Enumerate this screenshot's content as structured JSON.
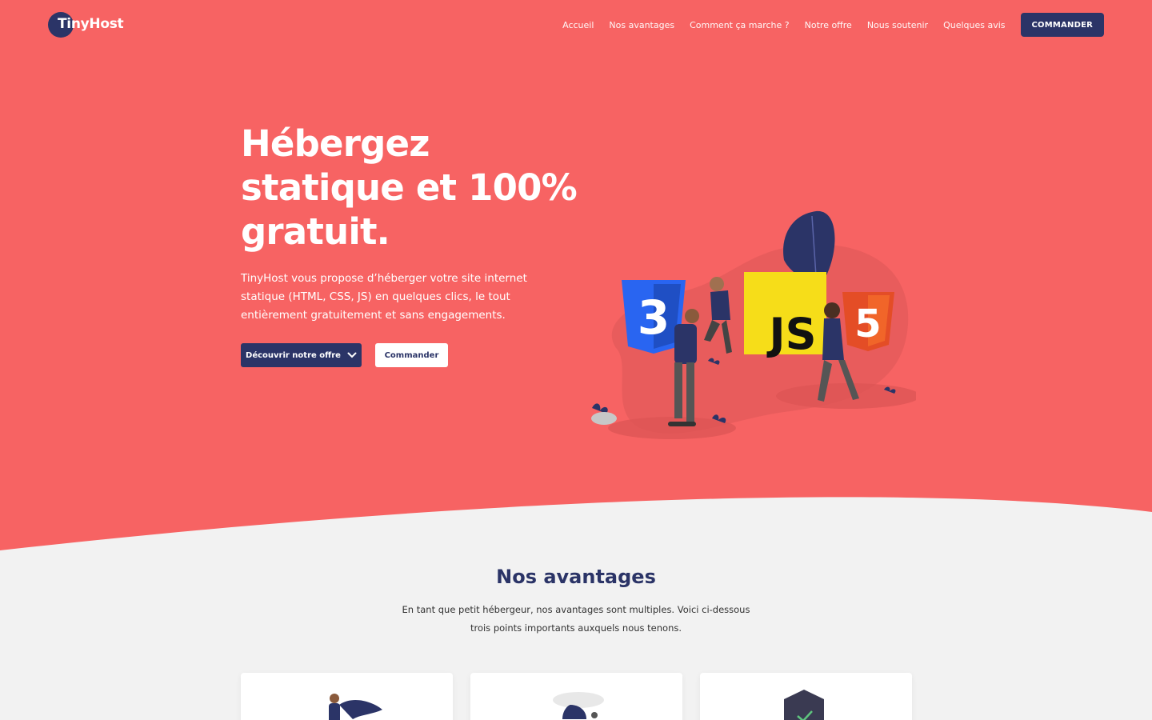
{
  "brand": {
    "name": "TinyHost"
  },
  "colors": {
    "primary": "#2b3467",
    "hero": "#f76363",
    "background": "#f2f2f2"
  },
  "nav": {
    "items": [
      "Accueil",
      "Nos avantages",
      "Comment ça marche ?",
      "Notre offre",
      "Nous soutenir",
      "Quelques avis"
    ],
    "cta": "COMMANDER"
  },
  "hero": {
    "title_lines": [
      "Hébergez",
      "statique et 100%",
      "gratuit."
    ],
    "description": "TinyHost vous propose d’héberger votre site internet statique (HTML, CSS, JS) en quelques clics, le tout entièrement gratuitement et sans engagements.",
    "primary_button": "Découvrir notre offre",
    "secondary_button": "Commander",
    "illustration_labels": {
      "js": "JS"
    }
  },
  "advantages": {
    "title": "Nos avantages",
    "description_lines": [
      "En tant que petit hébergeur, nos avantages sont multiples. Voici ci-dessous",
      "trois points importants auxquels nous tenons."
    ]
  },
  "icons": {
    "css": "css3-icon",
    "html": "html5-icon",
    "chevron": "chevron-down-icon"
  }
}
